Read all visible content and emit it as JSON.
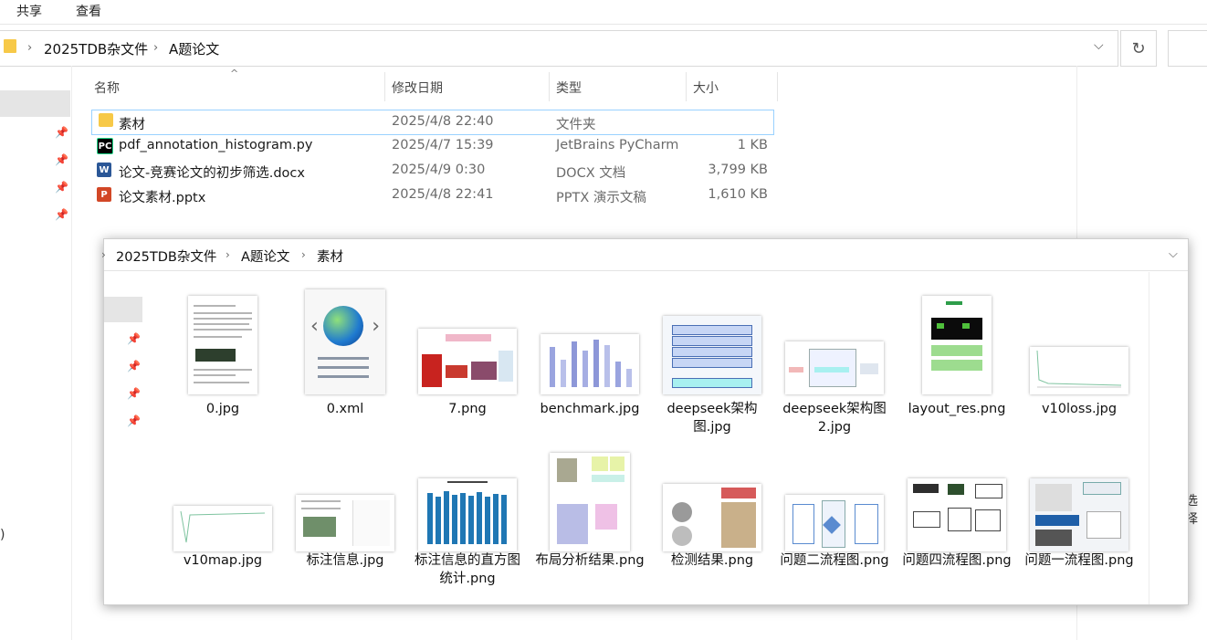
{
  "ribbon": {
    "tabs": [
      "共享",
      "查看"
    ]
  },
  "address": {
    "crumbs": [
      "2025TDB杂文件",
      "A题论文"
    ]
  },
  "columns": {
    "name": "名称",
    "modified": "修改日期",
    "type": "类型",
    "size": "大小"
  },
  "files": [
    {
      "name": "素材",
      "modified": "2025/4/8 22:40",
      "type": "文件夹",
      "size": "",
      "icon": "folder-icon"
    },
    {
      "name": "pdf_annotation_histogram.py",
      "modified": "2025/4/7 15:39",
      "type": "JetBrains PyCharm",
      "size": "1 KB",
      "icon": "pycharm-icon"
    },
    {
      "name": "论文-竞赛论文的初步筛选.docx",
      "modified": "2025/4/9 0:30",
      "type": "DOCX 文档",
      "size": "3,799 KB",
      "icon": "word-icon"
    },
    {
      "name": "论文素材.pptx",
      "modified": "2025/4/8 22:41",
      "type": "PPTX 演示文稿",
      "size": "1,610 KB",
      "icon": "powerpoint-icon"
    }
  ],
  "overlay": {
    "crumbs": [
      "2025TDB杂文件",
      "A题论文",
      "素材"
    ],
    "items": [
      {
        "label": "0.jpg"
      },
      {
        "label": "0.xml"
      },
      {
        "label": "7.png"
      },
      {
        "label": "benchmark.jpg"
      },
      {
        "label": "deepseek架构图.jpg"
      },
      {
        "label": "deepseek架构图2.jpg"
      },
      {
        "label": "layout_res.png"
      },
      {
        "label": "v10loss.jpg"
      },
      {
        "label": "v10map.jpg"
      },
      {
        "label": "标注信息.jpg"
      },
      {
        "label": "标注信息的直方图统计.png"
      },
      {
        "label": "布局分析结果.png"
      },
      {
        "label": "检测结果.png"
      },
      {
        "label": "问题二流程图.png"
      },
      {
        "label": "问题四流程图.png"
      },
      {
        "label": "问题一流程图.png"
      }
    ]
  },
  "edge_text": {
    "right": "选择",
    "left": ")"
  },
  "colors": {
    "selection_border": "#99d1ff",
    "folder": "#f7c948",
    "pycharm": "#21d789",
    "word": "#2b5797",
    "powerpoint": "#d24726",
    "chart_bar": "#1f77b4"
  }
}
